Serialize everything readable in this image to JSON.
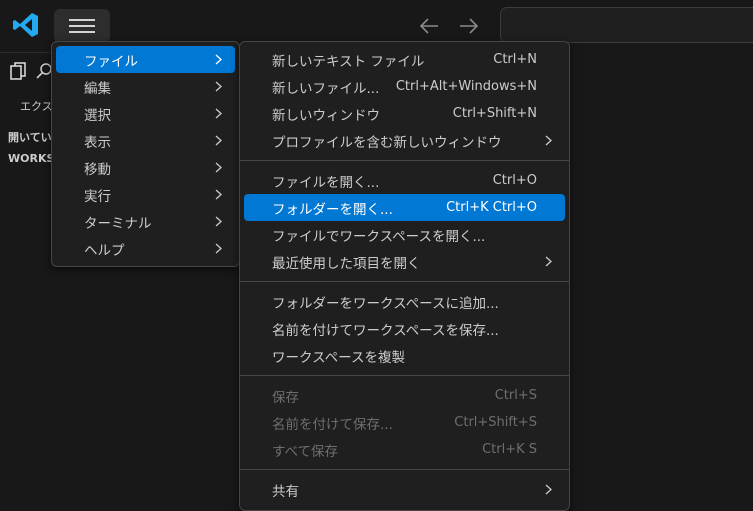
{
  "app": {
    "sidebar_title": "エクスプローラー",
    "sections": [
      "開いているエディター",
      "WORKSPACE"
    ]
  },
  "colors": {
    "accent": "#0078d4",
    "logo": "#23a9f2",
    "menu_bg": "#1f1f1f"
  },
  "icons": {
    "logo": "vscode-logo-icon",
    "menu": "hamburger-menu-icon",
    "back": "arrow-left-icon",
    "forward": "arrow-right-icon",
    "explorer": "files-icon",
    "search": "search-icon"
  },
  "main_menu": [
    {
      "label": "ファイル",
      "active": true
    },
    {
      "label": "編集"
    },
    {
      "label": "選択"
    },
    {
      "label": "表示"
    },
    {
      "label": "移動"
    },
    {
      "label": "実行"
    },
    {
      "label": "ターミナル"
    },
    {
      "label": "ヘルプ"
    }
  ],
  "file_menu": {
    "new_text_file": {
      "label": "新しいテキスト ファイル",
      "kb": "Ctrl+N"
    },
    "new_file": {
      "label": "新しいファイル...",
      "kb": "Ctrl+Alt+Windows+N"
    },
    "new_window": {
      "label": "新しいウィンドウ",
      "kb": "Ctrl+Shift+N"
    },
    "new_window_profile": {
      "label": "プロファイルを含む新しいウィンドウ"
    },
    "open_file": {
      "label": "ファイルを開く...",
      "kb": "Ctrl+O"
    },
    "open_folder": {
      "label": "フォルダーを開く...",
      "kb": "Ctrl+K Ctrl+O"
    },
    "open_workspace": {
      "label": "ファイルでワークスペースを開く..."
    },
    "open_recent": {
      "label": "最近使用した項目を開く"
    },
    "add_folder": {
      "label": "フォルダーをワークスペースに追加..."
    },
    "save_workspace_as": {
      "label": "名前を付けてワークスペースを保存..."
    },
    "duplicate_workspace": {
      "label": "ワークスペースを複製"
    },
    "save": {
      "label": "保存",
      "kb": "Ctrl+S"
    },
    "save_as": {
      "label": "名前を付けて保存...",
      "kb": "Ctrl+Shift+S"
    },
    "save_all": {
      "label": "すべて保存",
      "kb": "Ctrl+K S"
    },
    "share": {
      "label": "共有"
    }
  }
}
